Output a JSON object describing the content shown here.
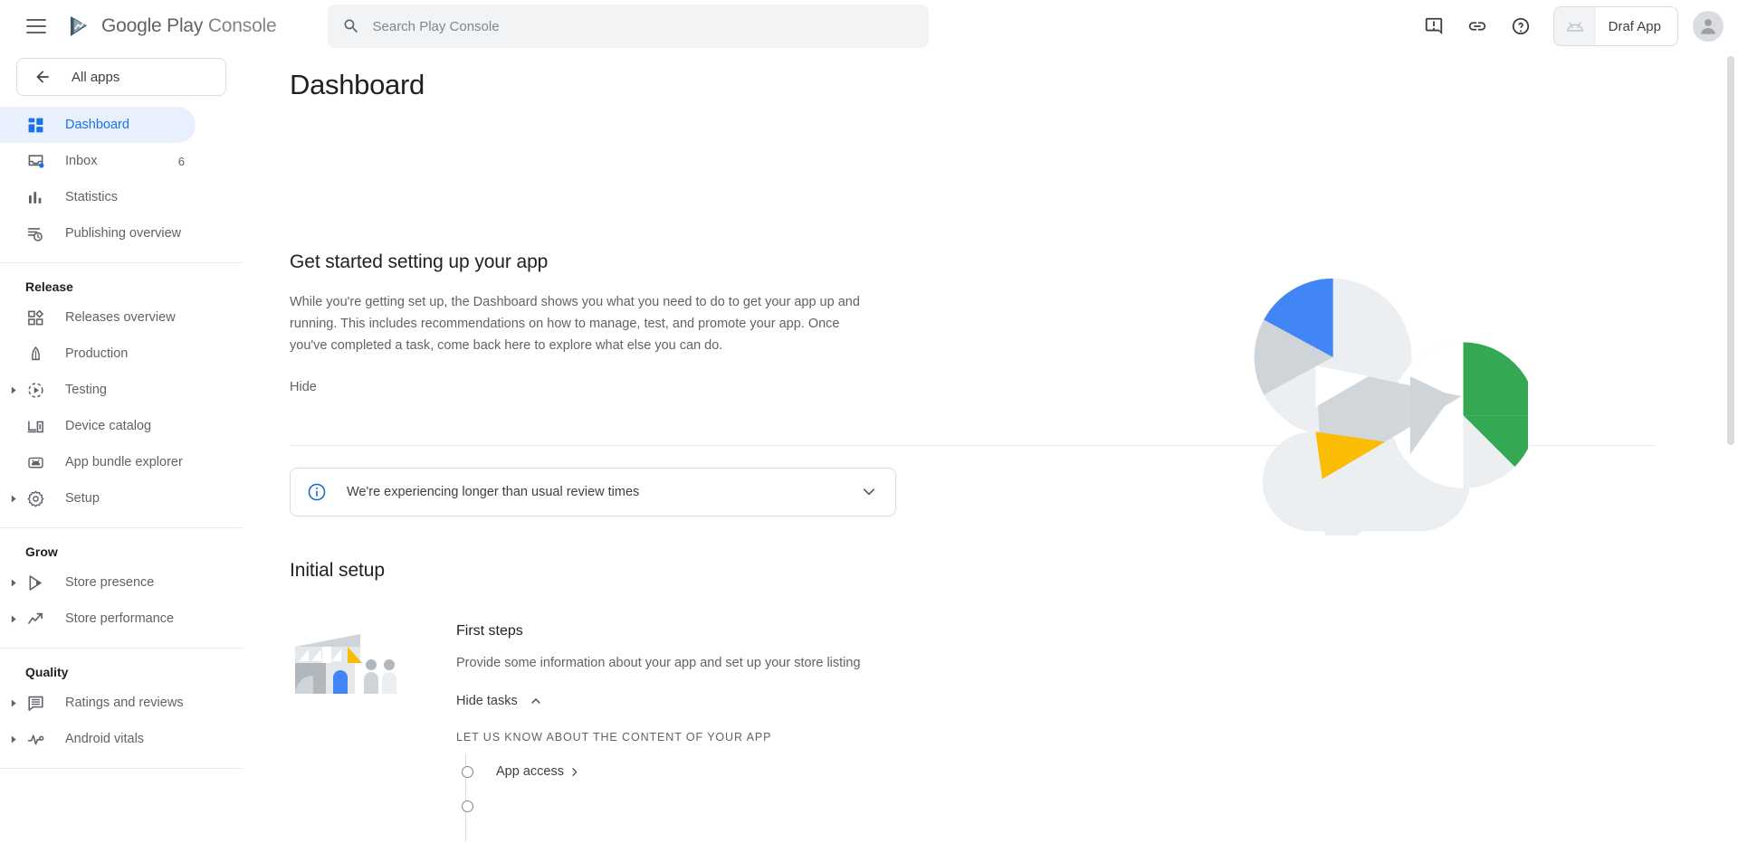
{
  "topbar": {
    "menu_icon": "hamburger-menu-icon",
    "brand_primary": "Google Play",
    "brand_secondary": "Console",
    "search": {
      "placeholder": "Search Play Console",
      "value": "",
      "icon": "search-icon"
    },
    "actions": [
      {
        "name": "feedback-icon",
        "label": "Send feedback"
      },
      {
        "name": "link-icon",
        "label": "Links"
      },
      {
        "name": "help-icon",
        "label": "Help"
      }
    ],
    "app_selector": {
      "label": "Draf App",
      "icon": "android-icon"
    },
    "avatar": {
      "name": "account-avatar",
      "label": "Account"
    }
  },
  "sidebar": {
    "all_apps_label": "All apps",
    "back_icon": "arrow-back-icon",
    "primary_items": [
      {
        "label": "Dashboard",
        "icon": "dashboard-icon",
        "active": true,
        "count": "",
        "expandable": false
      },
      {
        "label": "Inbox",
        "icon": "inbox-icon",
        "active": false,
        "count": "6",
        "expandable": false
      },
      {
        "label": "Statistics",
        "icon": "statistics-icon",
        "active": false,
        "count": "",
        "expandable": false
      },
      {
        "label": "Publishing overview",
        "icon": "publishing-overview-icon",
        "active": false,
        "count": "",
        "expandable": false
      }
    ],
    "groups": [
      {
        "heading": "Release",
        "items": [
          {
            "label": "Releases overview",
            "icon": "releases-overview-icon",
            "expandable": false
          },
          {
            "label": "Production",
            "icon": "production-icon",
            "expandable": false
          },
          {
            "label": "Testing",
            "icon": "testing-icon",
            "expandable": true
          },
          {
            "label": "Device catalog",
            "icon": "device-catalog-icon",
            "expandable": false
          },
          {
            "label": "App bundle explorer",
            "icon": "app-bundle-explorer-icon",
            "expandable": false
          },
          {
            "label": "Setup",
            "icon": "setup-gear-icon",
            "expandable": true
          }
        ]
      },
      {
        "heading": "Grow",
        "items": [
          {
            "label": "Store presence",
            "icon": "store-presence-icon",
            "expandable": true
          },
          {
            "label": "Store performance",
            "icon": "store-performance-icon",
            "expandable": true
          }
        ]
      },
      {
        "heading": "Quality",
        "items": [
          {
            "label": "Ratings and reviews",
            "icon": "ratings-reviews-icon",
            "expandable": true
          },
          {
            "label": "Android vitals",
            "icon": "android-vitals-icon",
            "expandable": true
          }
        ]
      }
    ]
  },
  "main": {
    "page_title": "Dashboard",
    "hero": {
      "heading": "Get started setting up your app",
      "paragraph": "While you're getting set up, the Dashboard shows you what you need to do to get your app up and running. This includes recommendations on how to manage, test, and promote your app. Once you've completed a task, come back here to explore what else you can do.",
      "hide_label": "Hide",
      "illustration": "dashboard-shapes-illustration"
    },
    "banner": {
      "icon": "info-icon",
      "text": "We're experiencing longer than usual review times",
      "expand_icon": "chevron-down-icon"
    },
    "initial_setup_heading": "Initial setup",
    "first_steps_card": {
      "illustration": "storefront-illustration",
      "title": "First steps",
      "description": "Provide some information about your app and set up your store listing",
      "toggle_label": "Hide tasks",
      "toggle_icon": "chevron-up-icon",
      "tasks_group_label": "LET US KNOW ABOUT THE CONTENT OF YOUR APP",
      "tasks": [
        {
          "label": "App access",
          "chevron": "chevron-right-icon",
          "done": false
        }
      ]
    }
  },
  "colors": {
    "accent_blue": "#1a73e8",
    "active_pill": "#e8f0fe",
    "text_primary": "#202124",
    "text_secondary": "#5f6368",
    "border": "#dadce0",
    "brand_green": "#34a853",
    "brand_yellow": "#fbbc04",
    "info_blue": "#1967d2"
  },
  "scrollbar": {
    "name": "page-scrollbar"
  }
}
